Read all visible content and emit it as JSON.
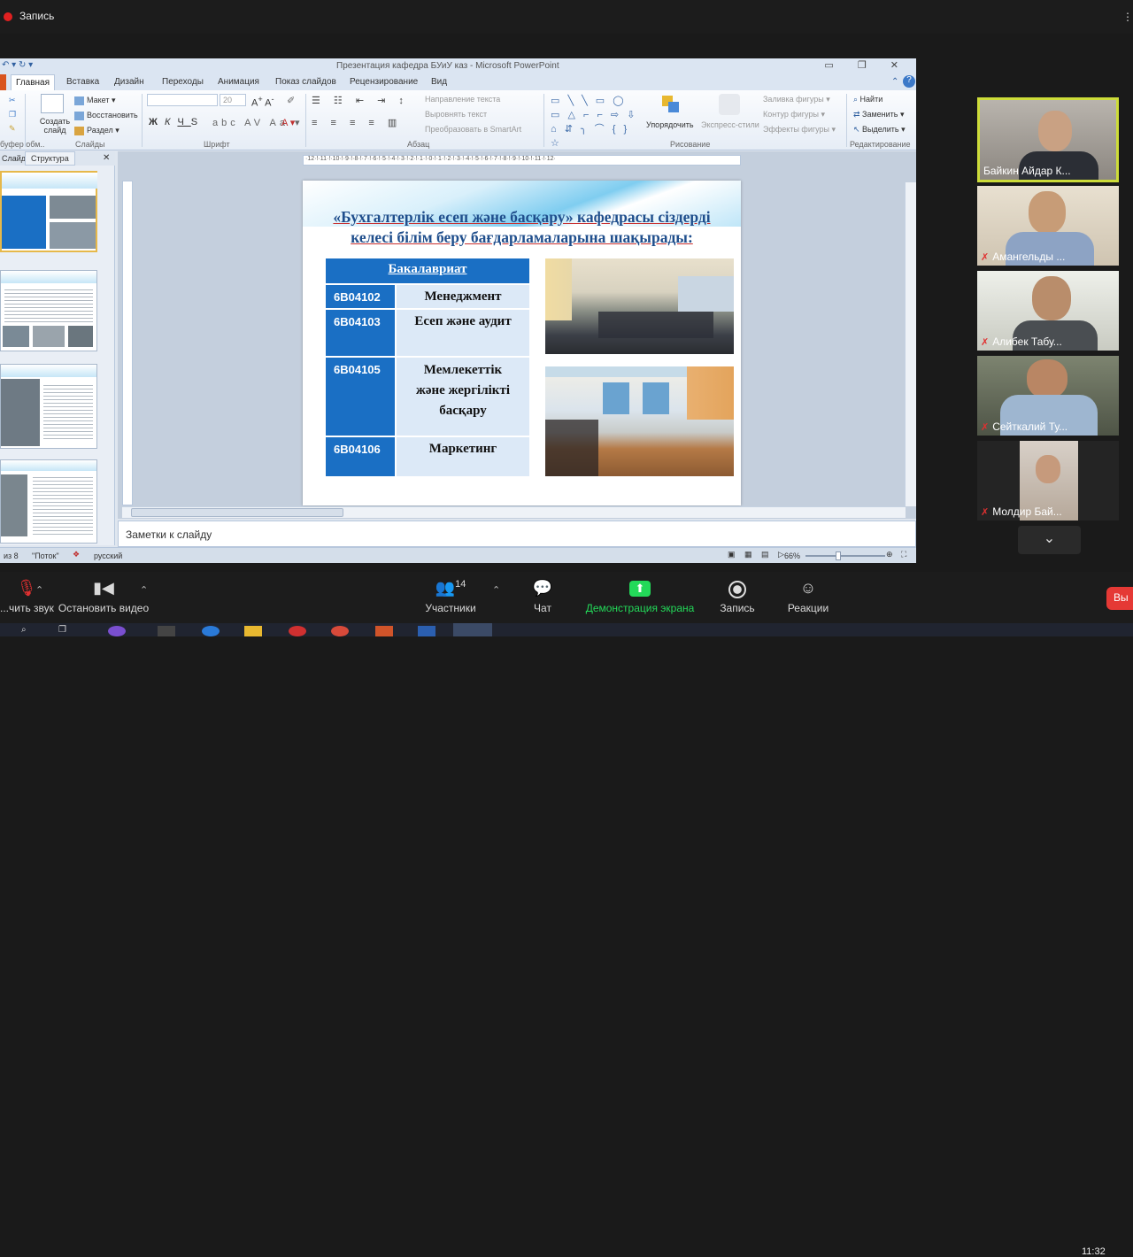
{
  "zoom_top": {
    "record_label": "Запись"
  },
  "powerpoint": {
    "window_title": "Презентация кафедра БУиУ каз - Microsoft PowerPoint",
    "tabs": [
      "Главная",
      "Вставка",
      "Дизайн",
      "Переходы",
      "Анимация",
      "Показ слайдов",
      "Рецензирование",
      "Вид"
    ],
    "ribbon": {
      "slides_group": {
        "create_slide": "Создать слайд",
        "layout": "Макет",
        "reset": "Восстановить",
        "section": "Раздел",
        "label": "Слайды",
        "left_label": "буфер обм.."
      },
      "font_group": {
        "font_size": "20",
        "label": "Шрифт"
      },
      "paragraph_group": {
        "text_direction": "Направление текста",
        "align_text": "Выровнять текст",
        "smartart": "Преобразовать в SmartArt",
        "label": "Абзац"
      },
      "drawing_group": {
        "arrange": "Упорядочить",
        "quick_styles": "Экспресс-стили",
        "shape_fill": "Заливка фигуры",
        "shape_outline": "Контур фигуры",
        "shape_effects": "Эффекты фигуры",
        "label": "Рисование"
      },
      "editing_group": {
        "find": "Найти",
        "replace": "Заменить",
        "select": "Выделить",
        "label": "Редактирование"
      }
    },
    "panel_tabs": {
      "slides": "Слайды",
      "outline": "Структура"
    },
    "ruler_text": "·12·!·11·!·10·!·9·!·8·!·7·!·6·!·5·!·4·!·3·!·2·!·1·!·0·!·1·!·2·!·3·!·4·!·5·!·6·!·7·!·8·!·9·!·10·!·11·!·12·",
    "slide": {
      "title_line1": "«Бухгалтерлік есеп және басқару» кафедрасы сіздерді",
      "title_line2": "келесі білім беру бағдарламаларына шақырады:",
      "table_header": "Бакалавриат",
      "rows": [
        {
          "code": "6В04102",
          "name": "Менеджмент"
        },
        {
          "code": "6В04103",
          "name": "Есеп және аудит"
        },
        {
          "code": "6В04105",
          "name": "Мемлекеттік және жергілікті басқару"
        },
        {
          "code": "6В04106",
          "name": "Маркетинг"
        }
      ]
    },
    "notes_placeholder": "Заметки к слайду",
    "status": {
      "slide_of": "из 8",
      "theme": "\"Поток\"",
      "language": "русский",
      "zoom": "66%"
    }
  },
  "participants": [
    {
      "name": "Байкин Айдар К...",
      "muted": false,
      "active": true
    },
    {
      "name": "Амангельды ...",
      "muted": true,
      "active": false
    },
    {
      "name": "Алибек Табу...",
      "muted": true,
      "active": false
    },
    {
      "name": "Сейткалий Ту...",
      "muted": true,
      "active": false
    },
    {
      "name": "Молдир Бай...",
      "muted": true,
      "active": false
    }
  ],
  "zoom_toolbar": {
    "mute": "...чить звук",
    "stop_video": "Остановить видео",
    "participants": "Участники",
    "participants_count": "14",
    "chat": "Чат",
    "share_screen": "Демонстрация экрана",
    "record": "Запись",
    "reactions": "Реакции",
    "end": "Вы"
  },
  "taskbar": {
    "time": "11:32"
  },
  "colors": {
    "zoom_bg": "#1c1c1c",
    "share_green": "#23d959",
    "slide_blue": "#1a6fc4",
    "title_blue": "#1f4e8c"
  }
}
